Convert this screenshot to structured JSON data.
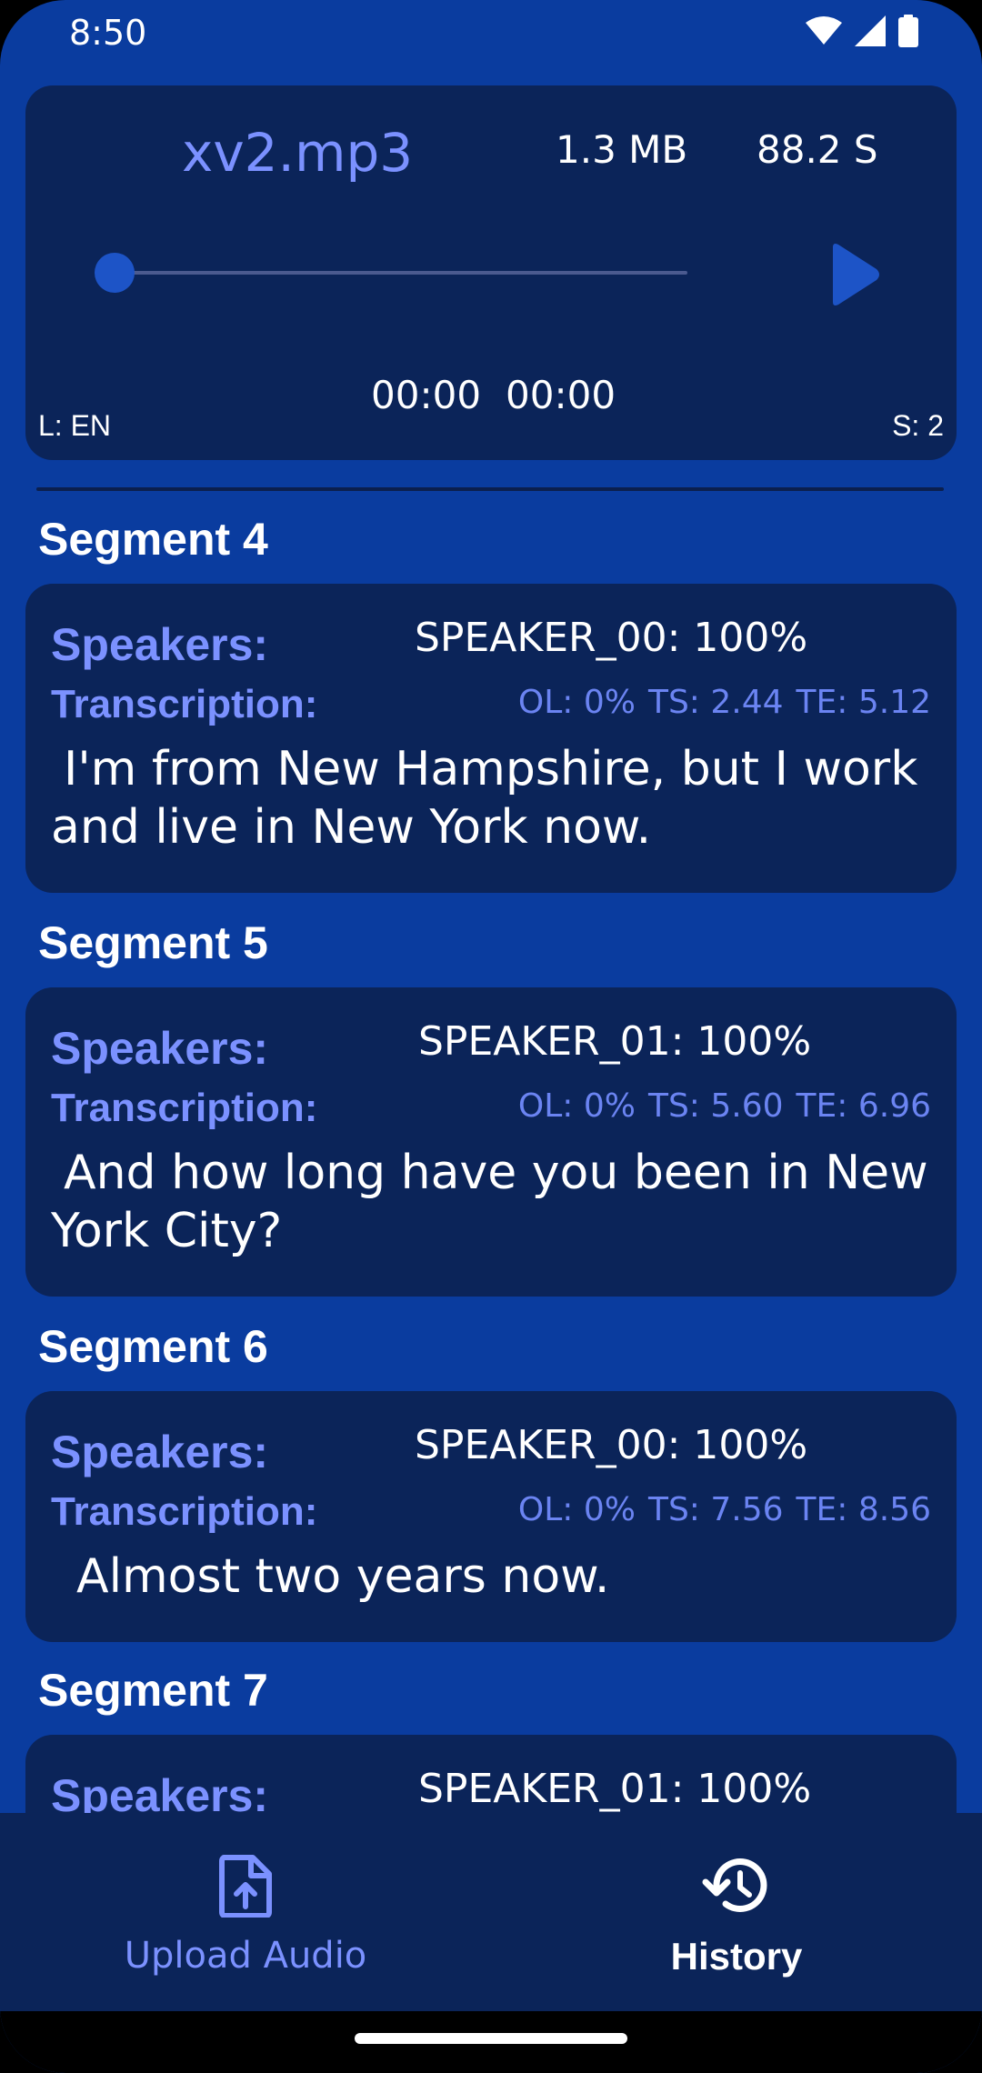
{
  "status_bar": {
    "time": "8:50",
    "icons": [
      "wifi-icon",
      "signal-icon",
      "battery-icon"
    ]
  },
  "player": {
    "file_name": "xv2.mp3",
    "file_size": "1.3 MB",
    "duration": "88.2 S",
    "progress": 0,
    "time_current": "00:00",
    "time_total": "00:00",
    "language": "L: EN",
    "speakers": "S: 2",
    "play_icon": "play-icon"
  },
  "segments": [
    {
      "title": "Segment 4",
      "speakers_label": "Speakers:",
      "speakers_value": "SPEAKER_00: 100%",
      "transcription_label": "Transcription:",
      "ol": "OL: 0%",
      "ts": "TS: 2.44",
      "te": "TE: 5.12",
      "text": "I'm from New Hampshire, but I work and live in New York now."
    },
    {
      "title": "Segment 5",
      "speakers_label": "Speakers:",
      "speakers_value": "SPEAKER_01: 100%",
      "transcription_label": "Transcription:",
      "ol": "OL: 0%",
      "ts": "TS: 5.60",
      "te": "TE: 6.96",
      "text": "And how long have you been in New York City?"
    },
    {
      "title": "Segment 6",
      "speakers_label": "Speakers:",
      "speakers_value": "SPEAKER_00: 100%",
      "transcription_label": "Transcription:",
      "ol": "OL: 0%",
      "ts": "TS: 7.56",
      "te": "TE: 8.56",
      "text": "Almost two years now."
    },
    {
      "title": "Segment 7",
      "speakers_label": "Speakers:",
      "speakers_value": "SPEAKER_01: 100%"
    }
  ],
  "nav": {
    "upload_label": "Upload Audio",
    "history_label": "History",
    "upload_icon": "upload-file-icon",
    "history_icon": "history-icon",
    "active": "history"
  },
  "colors": {
    "background": "#0a3c9f",
    "card": "#0b2459",
    "accent": "#7b91ff"
  }
}
